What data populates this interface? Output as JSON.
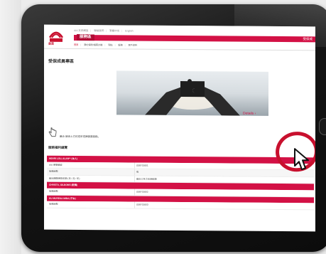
{
  "header": {
    "logo_text": "AIA",
    "home_label": "首頁",
    "top_links": [
      "AIA 友邦網頁",
      "聯絡我們",
      "繁體中文",
      "English"
    ],
    "title_tab": "服務區",
    "title_right": "受保成"
  },
  "nav": {
    "items": [
      "首頁",
      "我的保險/儲蓄計劃",
      "理賠",
      "服務",
      "保戶資料"
    ]
  },
  "page": {
    "title": "受保成員專區",
    "banner_link": "Details ›",
    "hint": "最近 請由上方的選單選擇需要服務。",
    "section_title": "服務福利總覽"
  },
  "table": {
    "rows": [
      {
        "type": "head",
        "text": "HENRI LOU, ALAN** (本人)"
      },
      {
        "type": "data",
        "a": "AIA 保單編號",
        "b": "G08702601"
      },
      {
        "type": "data",
        "a": "受保狀態",
        "b": "有"
      },
      {
        "type": "data",
        "a": "最近期間保險年期 (日 / 月 / 年)",
        "b": "最近三年之住院紀錄"
      },
      {
        "type": "head",
        "text": "CHRISTA, GILBOMS (配偶)"
      },
      {
        "type": "data",
        "a": "受保狀態",
        "b": "G08702602"
      },
      {
        "type": "head",
        "text": "KU MUREKA MIBA (子女)"
      },
      {
        "type": "data",
        "a": "受保狀態",
        "b": "G08702603"
      }
    ]
  },
  "colors": {
    "brand_red": "#d31145",
    "annotation_red": "#c8102e"
  }
}
